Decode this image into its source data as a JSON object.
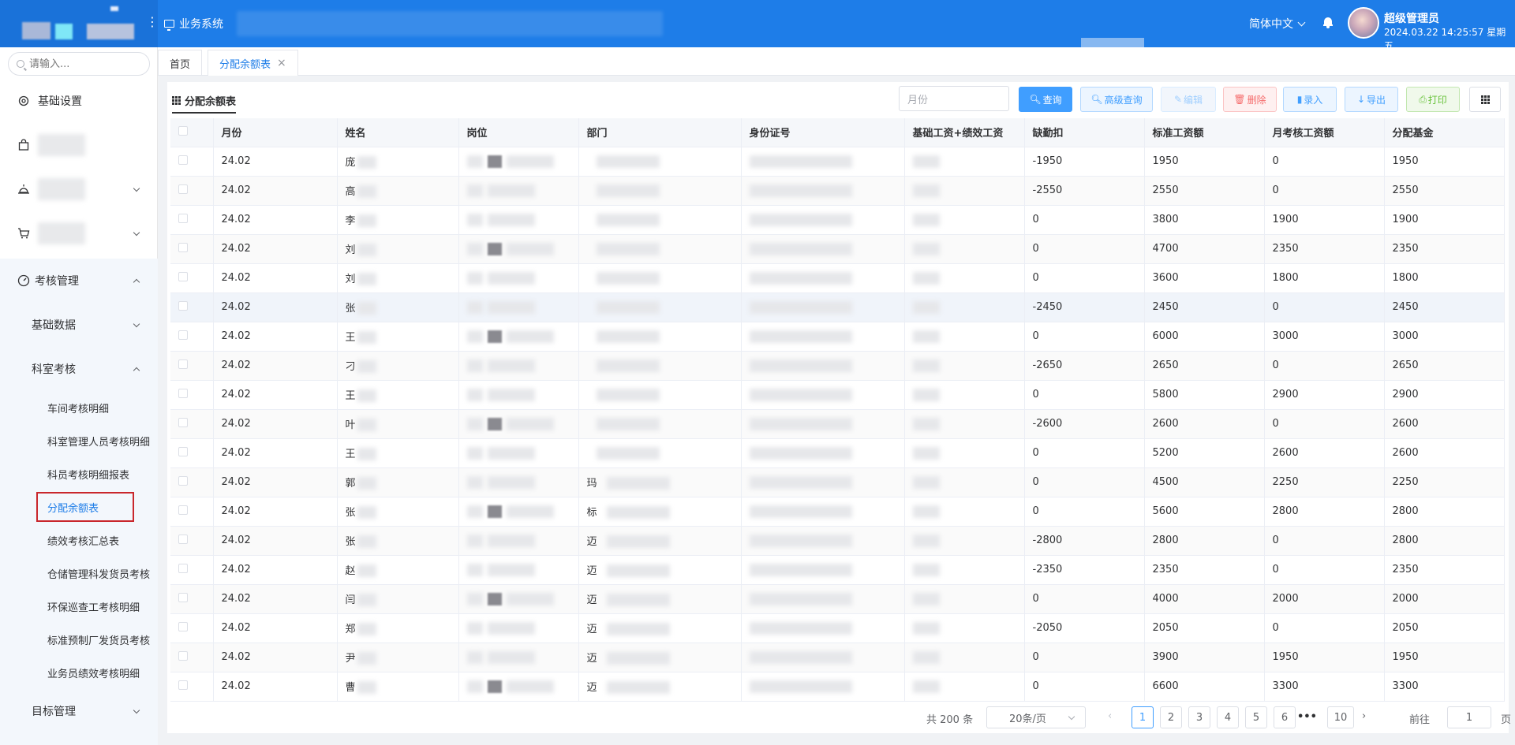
{
  "header": {
    "system_label": "业务系统",
    "language": "简体中文",
    "user_name": "超级管理员",
    "datetime": "2024.03.22 14:25:57 星期五"
  },
  "sidebar": {
    "search_placeholder": "请输入...",
    "top_items": [
      {
        "label": "基础设置",
        "icon": "gear-icon"
      },
      {
        "label": "",
        "icon": "bag-icon"
      },
      {
        "label": "",
        "icon": "alarm-icon"
      },
      {
        "label": "",
        "icon": "cart-icon"
      }
    ],
    "exam": {
      "label": "考核管理",
      "icon": "gauge-icon",
      "basic_data": "基础数据",
      "dept_exam": "科室考核",
      "subitems": [
        "车间考核明细",
        "科室管理人员考核明细",
        "科员考核明细报表",
        "分配余额表",
        "绩效考核汇总表",
        "仓储管理科发货员考核",
        "环保巡查工考核明细",
        "标准预制厂发货员考核",
        "业务员绩效考核明细"
      ],
      "target": "目标管理"
    }
  },
  "tabs": [
    {
      "label": "首页"
    },
    {
      "label": "分配余额表",
      "close": "×"
    }
  ],
  "panel": {
    "title": "分配余额表",
    "month_placeholder": "月份",
    "buttons": {
      "query": "查询",
      "advanced": "高级查询",
      "edit": "编辑",
      "delete": "删除",
      "entry": "录入",
      "export": "导出",
      "print": "打印"
    }
  },
  "table": {
    "columns": [
      "月份",
      "姓名",
      "岗位",
      "部门",
      "身份证号",
      "基础工资+绩效工资",
      "缺勤扣",
      "标准工资额",
      "月考核工资额",
      "分配基金"
    ],
    "rows": [
      {
        "month": "24.02",
        "name": "庞",
        "dept": "",
        "absence": "-1950",
        "std": "1950",
        "monthly": "0",
        "fund": "1950"
      },
      {
        "month": "24.02",
        "name": "高",
        "dept": "",
        "absence": "-2550",
        "std": "2550",
        "monthly": "0",
        "fund": "2550"
      },
      {
        "month": "24.02",
        "name": "李",
        "dept": "",
        "absence": "0",
        "std": "3800",
        "monthly": "1900",
        "fund": "1900"
      },
      {
        "month": "24.02",
        "name": "刘",
        "dept": "",
        "absence": "0",
        "std": "4700",
        "monthly": "2350",
        "fund": "2350"
      },
      {
        "month": "24.02",
        "name": "刘",
        "dept": "",
        "absence": "0",
        "std": "3600",
        "monthly": "1800",
        "fund": "1800"
      },
      {
        "month": "24.02",
        "name": "张",
        "dept": "",
        "absence": "-2450",
        "std": "2450",
        "monthly": "0",
        "fund": "2450"
      },
      {
        "month": "24.02",
        "name": "王",
        "dept": "",
        "absence": "0",
        "std": "6000",
        "monthly": "3000",
        "fund": "3000"
      },
      {
        "month": "24.02",
        "name": "刁",
        "dept": "",
        "absence": "-2650",
        "std": "2650",
        "monthly": "0",
        "fund": "2650"
      },
      {
        "month": "24.02",
        "name": "王",
        "dept": "",
        "absence": "0",
        "std": "5800",
        "monthly": "2900",
        "fund": "2900"
      },
      {
        "month": "24.02",
        "name": "叶",
        "dept": "",
        "absence": "-2600",
        "std": "2600",
        "monthly": "0",
        "fund": "2600"
      },
      {
        "month": "24.02",
        "name": "王",
        "dept": "",
        "absence": "0",
        "std": "5200",
        "monthly": "2600",
        "fund": "2600"
      },
      {
        "month": "24.02",
        "name": "郭",
        "dept": "玛",
        "absence": "0",
        "std": "4500",
        "monthly": "2250",
        "fund": "2250"
      },
      {
        "month": "24.02",
        "name": "张",
        "dept": "标",
        "absence": "0",
        "std": "5600",
        "monthly": "2800",
        "fund": "2800"
      },
      {
        "month": "24.02",
        "name": "张",
        "dept": "迈",
        "absence": "-2800",
        "std": "2800",
        "monthly": "0",
        "fund": "2800"
      },
      {
        "month": "24.02",
        "name": "赵",
        "dept": "迈",
        "absence": "-2350",
        "std": "2350",
        "monthly": "0",
        "fund": "2350"
      },
      {
        "month": "24.02",
        "name": "闫",
        "dept": "迈",
        "absence": "0",
        "std": "4000",
        "monthly": "2000",
        "fund": "2000"
      },
      {
        "month": "24.02",
        "name": "郑",
        "dept": "迈",
        "absence": "-2050",
        "std": "2050",
        "monthly": "0",
        "fund": "2050"
      },
      {
        "month": "24.02",
        "name": "尹",
        "dept": "迈",
        "absence": "0",
        "std": "3900",
        "monthly": "1950",
        "fund": "1950"
      },
      {
        "month": "24.02",
        "name": "曹",
        "dept": "迈",
        "absence": "0",
        "std": "6600",
        "monthly": "3300",
        "fund": "3300"
      }
    ]
  },
  "pagination": {
    "total": "共 200 条",
    "page_size": "20条/页",
    "pages": [
      "1",
      "2",
      "3",
      "4",
      "5",
      "6"
    ],
    "ellipsis": "•••",
    "last": "10",
    "goto_label": "前往",
    "goto_value": "1",
    "page_suffix": "页",
    "prev": "‹",
    "next": "›"
  }
}
